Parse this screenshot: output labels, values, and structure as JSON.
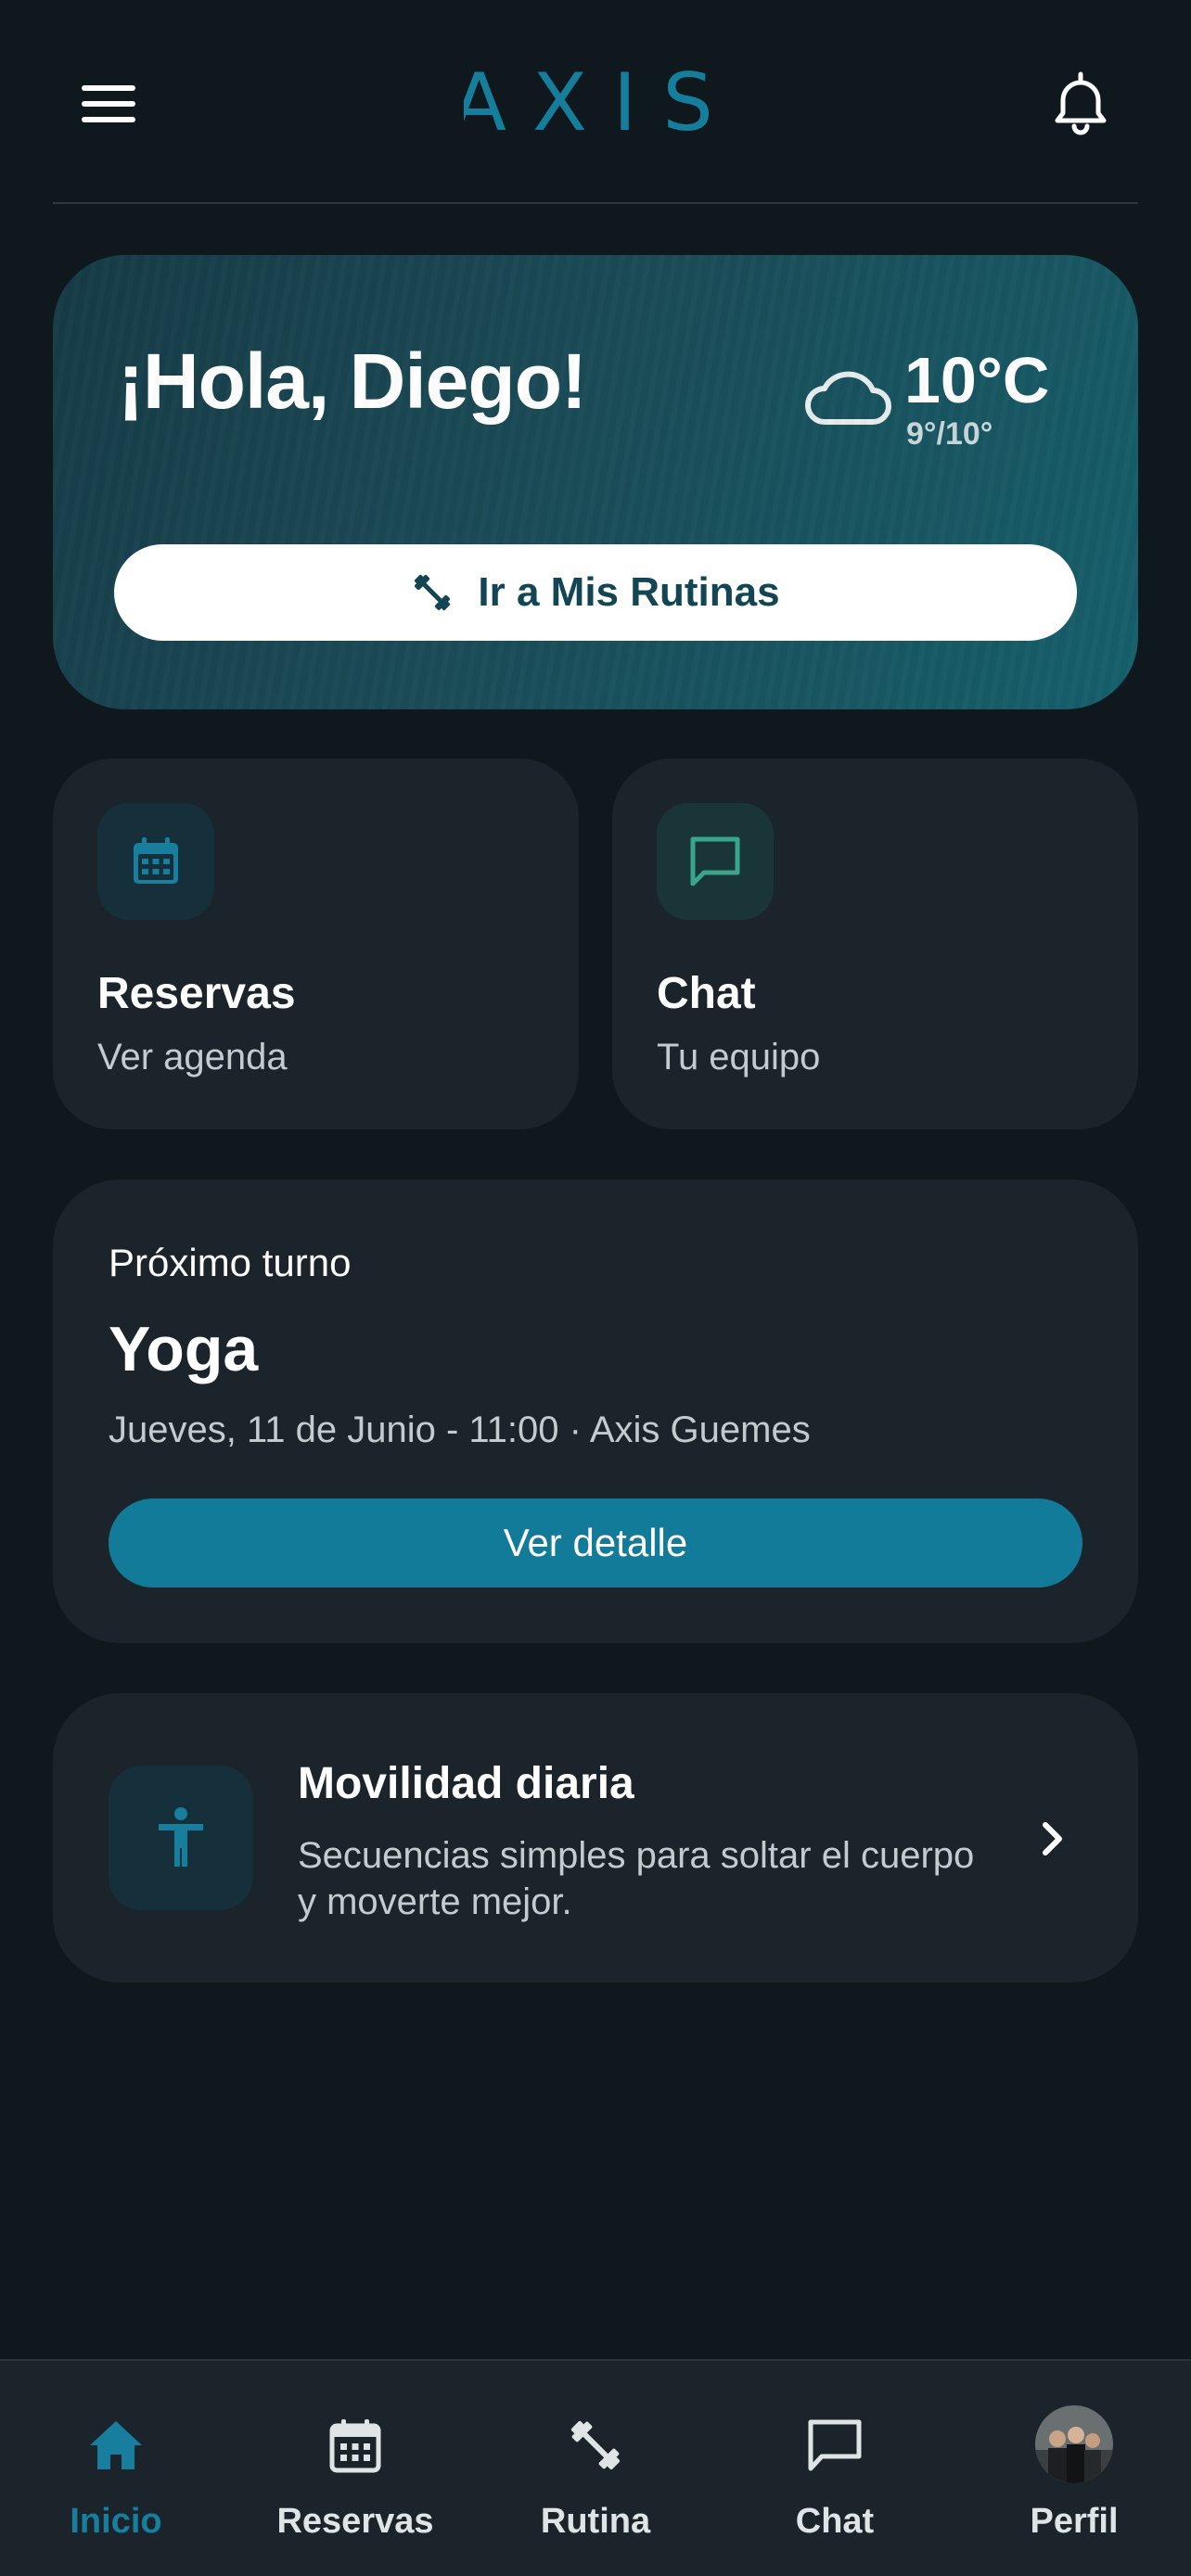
{
  "app": {
    "logo_text": "AXIS"
  },
  "hero": {
    "greeting": "¡Hola, Diego!",
    "temperature": "10°C",
    "temp_range": "9°/10°",
    "weather_icon": "cloud-icon",
    "routine_button_label": "Ir a Mis Rutinas"
  },
  "quick": [
    {
      "title": "Reservas",
      "subtitle": "Ver agenda",
      "icon": "calendar-icon"
    },
    {
      "title": "Chat",
      "subtitle": "Tu equipo",
      "icon": "chat-bubble-icon"
    }
  ],
  "next_turn": {
    "label": "Próximo turno",
    "class_name": "Yoga",
    "when": "Jueves, 11 de Junio - 11:00 · Axis Guemes",
    "button_label": "Ver detalle"
  },
  "mobility": {
    "title": "Movilidad diaria",
    "description": "Secuencias simples para soltar el cuerpo y moverte mejor.",
    "icon": "accessibility-icon"
  },
  "bottom_nav": [
    {
      "label": "Inicio",
      "icon": "home-icon",
      "active": true
    },
    {
      "label": "Reservas",
      "icon": "calendar-icon",
      "active": false
    },
    {
      "label": "Rutina",
      "icon": "dumbbell-icon",
      "active": false
    },
    {
      "label": "Chat",
      "icon": "chat-bubble-icon",
      "active": false
    },
    {
      "label": "Perfil",
      "icon": "avatar",
      "active": false
    }
  ],
  "colors": {
    "background": "#0f181d",
    "card": "#1b242a",
    "accent": "#137b9a",
    "brand": "#177e9d",
    "hero_start": "#163b46",
    "hero_end": "#15606c",
    "chat_accent": "#3aa58a"
  }
}
